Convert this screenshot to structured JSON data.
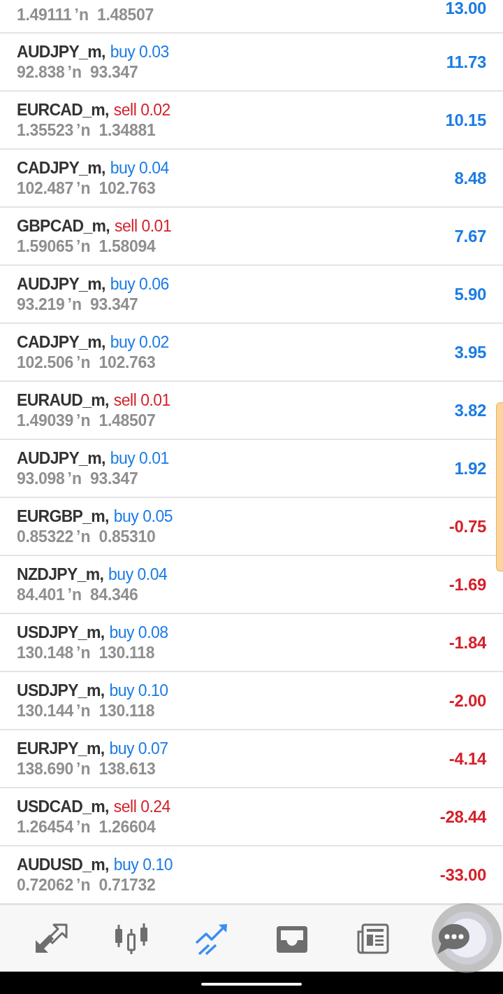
{
  "positions": [
    {
      "open_price": "1.49111",
      "separator": "ʼn",
      "current_price": "1.48507",
      "profit": "13.00",
      "loss": false
    },
    {
      "symbol": "AUDJPY_m,",
      "order": "buy 0.03",
      "kind": "buy",
      "open_price": "92.838",
      "separator": "ʼn",
      "current_price": "93.347",
      "profit": "11.73",
      "loss": false
    },
    {
      "symbol": "EURCAD_m,",
      "order": "sell 0.02",
      "kind": "sell",
      "open_price": "1.35523",
      "separator": "ʼn",
      "current_price": "1.34881",
      "profit": "10.15",
      "loss": false
    },
    {
      "symbol": "CADJPY_m,",
      "order": "buy 0.04",
      "kind": "buy",
      "open_price": "102.487",
      "separator": "ʼn",
      "current_price": "102.763",
      "profit": "8.48",
      "loss": false
    },
    {
      "symbol": "GBPCAD_m,",
      "order": "sell 0.01",
      "kind": "sell",
      "open_price": "1.59065",
      "separator": "ʼn",
      "current_price": "1.58094",
      "profit": "7.67",
      "loss": false
    },
    {
      "symbol": "AUDJPY_m,",
      "order": "buy 0.06",
      "kind": "buy",
      "open_price": "93.219",
      "separator": "ʼn",
      "current_price": "93.347",
      "profit": "5.90",
      "loss": false
    },
    {
      "symbol": "CADJPY_m,",
      "order": "buy 0.02",
      "kind": "buy",
      "open_price": "102.506",
      "separator": "ʼn",
      "current_price": "102.763",
      "profit": "3.95",
      "loss": false
    },
    {
      "symbol": "EURAUD_m,",
      "order": "sell 0.01",
      "kind": "sell",
      "open_price": "1.49039",
      "separator": "ʼn",
      "current_price": "1.48507",
      "profit": "3.82",
      "loss": false
    },
    {
      "symbol": "AUDJPY_m,",
      "order": "buy 0.01",
      "kind": "buy",
      "open_price": "93.098",
      "separator": "ʼn",
      "current_price": "93.347",
      "profit": "1.92",
      "loss": false
    },
    {
      "symbol": "EURGBP_m,",
      "order": "buy 0.05",
      "kind": "buy",
      "open_price": "0.85322",
      "separator": "ʼn",
      "current_price": "0.85310",
      "profit": "-0.75",
      "loss": true
    },
    {
      "symbol": "NZDJPY_m,",
      "order": "buy 0.04",
      "kind": "buy",
      "open_price": "84.401",
      "separator": "ʼn",
      "current_price": "84.346",
      "profit": "-1.69",
      "loss": true
    },
    {
      "symbol": "USDJPY_m,",
      "order": "buy 0.08",
      "kind": "buy",
      "open_price": "130.148",
      "separator": "ʼn",
      "current_price": "130.118",
      "profit": "-1.84",
      "loss": true
    },
    {
      "symbol": "USDJPY_m,",
      "order": "buy 0.10",
      "kind": "buy",
      "open_price": "130.144",
      "separator": "ʼn",
      "current_price": "130.118",
      "profit": "-2.00",
      "loss": true
    },
    {
      "symbol": "EURJPY_m,",
      "order": "buy 0.07",
      "kind": "buy",
      "open_price": "138.690",
      "separator": "ʼn",
      "current_price": "138.613",
      "profit": "-4.14",
      "loss": true
    },
    {
      "symbol": "USDCAD_m,",
      "order": "sell 0.24",
      "kind": "sell",
      "open_price": "1.26454",
      "separator": "ʼn",
      "current_price": "1.26604",
      "profit": "-28.44",
      "loss": true
    },
    {
      "symbol": "AUDUSD_m,",
      "order": "buy 0.10",
      "kind": "buy",
      "open_price": "0.72062",
      "separator": "ʼn",
      "current_price": "0.71732",
      "profit": "-33.00",
      "loss": true
    }
  ],
  "bottom_nav": [
    {
      "selected": false
    },
    {
      "selected": false
    },
    {
      "selected": true
    },
    {
      "selected": false
    },
    {
      "selected": false
    },
    {
      "selected": false
    }
  ]
}
